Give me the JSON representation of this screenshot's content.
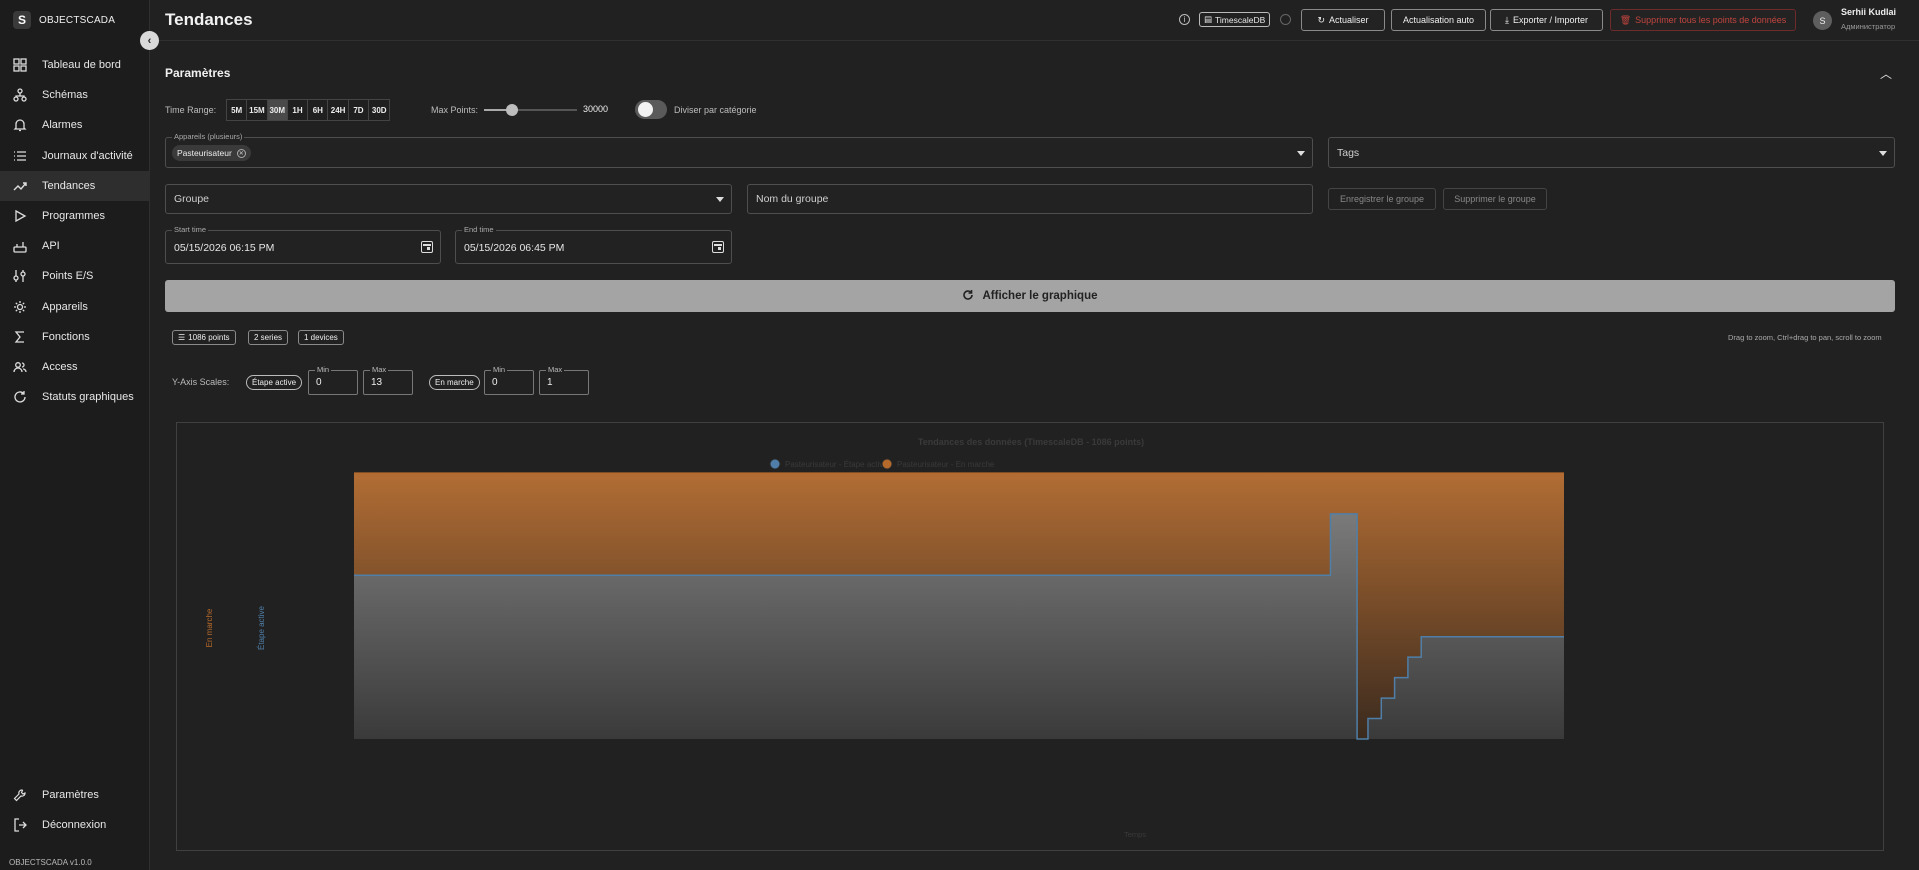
{
  "brand": {
    "logo_letter": "S",
    "name": "OBJECTSCADA"
  },
  "sidebar": {
    "items": [
      {
        "label": "Tableau de bord",
        "icon": "dashboard-icon"
      },
      {
        "label": "Schémas",
        "icon": "diagram-icon"
      },
      {
        "label": "Alarmes",
        "icon": "bell-icon"
      },
      {
        "label": "Journaux d'activité",
        "icon": "list-icon"
      },
      {
        "label": "Tendances",
        "icon": "trending-icon",
        "active": true
      },
      {
        "label": "Programmes",
        "icon": "play-icon"
      },
      {
        "label": "API",
        "icon": "router-icon"
      },
      {
        "label": "Points E/S",
        "icon": "io-points-icon"
      },
      {
        "label": "Appareils",
        "icon": "gear-icon"
      },
      {
        "label": "Fonctions",
        "icon": "sigma-icon"
      },
      {
        "label": "Access",
        "icon": "users-icon"
      },
      {
        "label": "Statuts graphiques",
        "icon": "refresh-icon"
      }
    ],
    "bottom": [
      {
        "label": "Paramètres",
        "icon": "wrench-icon"
      },
      {
        "label": "Déconnexion",
        "icon": "logout-icon"
      }
    ],
    "version": "OBJECTSCADA v1.0.0"
  },
  "header": {
    "title": "Tendances",
    "db_label": "TimescaleDB",
    "refresh_label": "Actualiser",
    "auto_refresh_label": "Actualisation auto",
    "export_label": "Exporter / Importer",
    "delete_label": "Supprimer tous les points de données",
    "user_initial": "S",
    "user_name": "Serhii Kudlai",
    "user_role": "Администратор"
  },
  "params": {
    "title": "Paramètres",
    "time_range_label": "Time Range:",
    "time_ranges": [
      "5M",
      "15M",
      "30M",
      "1H",
      "6H",
      "24H",
      "7D",
      "30D"
    ],
    "time_range_selected": "30M",
    "max_points_label": "Max Points:",
    "max_points_value": "30000",
    "max_points_fraction": 0.3,
    "split_label": "Diviser par catégorie",
    "split_enabled": false,
    "devices_label": "Appareils (plusieurs)",
    "devices_selected": "Pasteurisateur",
    "tags_placeholder": "Tags",
    "group_placeholder": "Groupe",
    "group_name_placeholder": "Nom du groupe",
    "save_group_label": "Enregistrer le groupe",
    "delete_group_label": "Supprimer le groupe",
    "start_label": "Start time",
    "start_value": "05/15/2026 06:15 PM",
    "end_label": "End time",
    "end_value": "05/15/2026 06:45 PM",
    "show_chart_label": "Afficher le graphique"
  },
  "stats": {
    "points": "1086 points",
    "series": "2 series",
    "devices": "1 devices",
    "hint": "Drag to zoom, Ctrl+drag to pan, scroll to zoom"
  },
  "yscales": {
    "label": "Y-Axis Scales:",
    "min_label": "Min",
    "max_label": "Max",
    "scale1": {
      "name": "Étape active",
      "min": "0",
      "max": "13"
    },
    "scale2": {
      "name": "En marche",
      "min": "0",
      "max": "1"
    }
  },
  "chart_data": {
    "type": "area",
    "title": "Tendances des données (TimescaleDB - 1086 points)",
    "xlabel": "Temps",
    "series": [
      {
        "name": "Pasteurisateur - Étape active",
        "color": "#4f7fa8",
        "step_x": [
          0,
          0.807,
          0.807,
          0.829,
          0.829,
          0.838,
          0.838,
          0.849,
          0.849,
          0.86,
          0.86,
          0.871,
          0.871,
          0.882,
          0.882,
          1
        ],
        "step_y": [
          8,
          8,
          11,
          11,
          0,
          0,
          1,
          1,
          2,
          2,
          3,
          3,
          4,
          4,
          5,
          5
        ]
      },
      {
        "name": "Pasteurisateur - En marche",
        "color": "#b5692a",
        "step_x": [
          0,
          1
        ],
        "step_y": [
          1,
          1
        ]
      }
    ],
    "y_left_label": "Étape active",
    "y_right_label": "En marche",
    "ylim_step": [
      0,
      13
    ],
    "ylim_run": [
      0,
      1
    ],
    "grid": false,
    "legend": "top"
  }
}
